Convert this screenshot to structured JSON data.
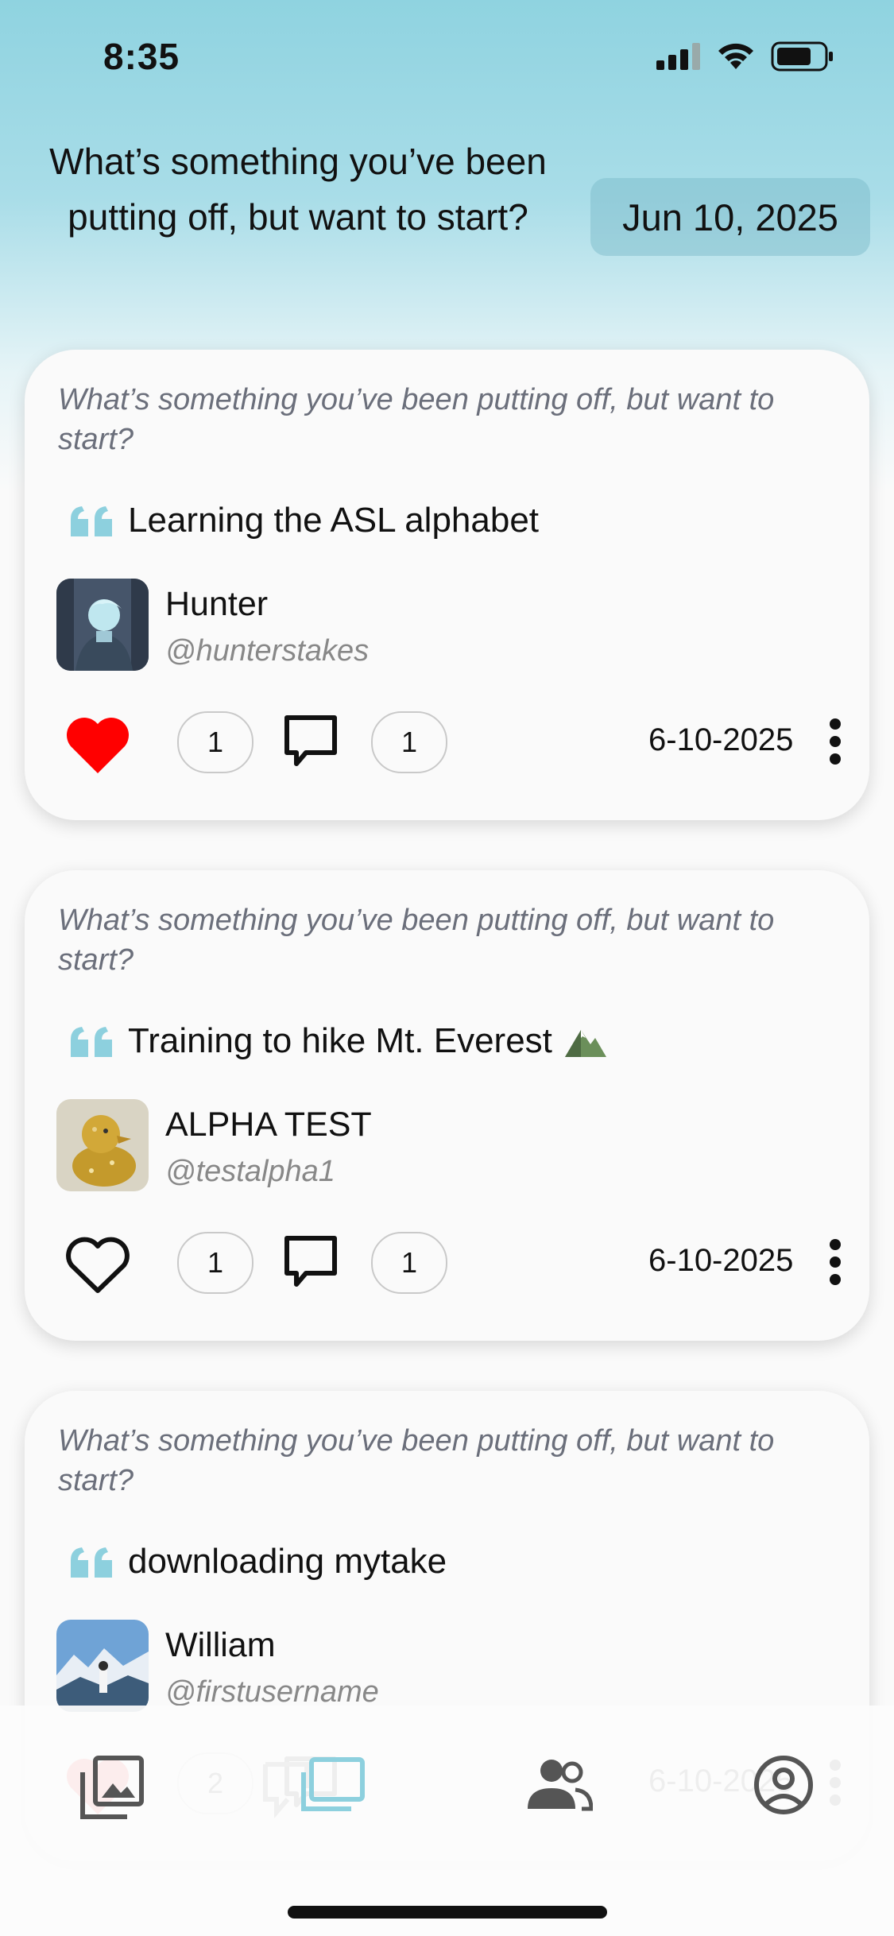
{
  "status_bar": {
    "time": "8:35"
  },
  "header": {
    "question": "What’s something you’ve been putting off, but want to start?",
    "date": "Jun 10, 2025"
  },
  "posts": [
    {
      "prompt": "What’s something you’ve been putting off, but want to start?",
      "answer": "Learning the ASL alphabet",
      "name": "Hunter",
      "handle": "@hunterstakes",
      "likes": "1",
      "comments": "1",
      "date": "6-10-2025",
      "liked": true
    },
    {
      "prompt": "What’s something you’ve been putting off, but want to start?",
      "answer": "Training to hike Mt. Everest",
      "name": "ALPHA TEST",
      "handle": "@testalpha1",
      "likes": "1",
      "comments": "1",
      "date": "6-10-2025",
      "liked": false
    },
    {
      "prompt": "What’s something you’ve been putting off, but want to start?",
      "answer": "downloading mytake",
      "name": "William",
      "handle": "@firstusername",
      "likes": "2",
      "comments": "",
      "date": "6-10-2025",
      "liked": true
    }
  ],
  "icons": [
    "quote-icon",
    "heart-icon",
    "comment-icon",
    "more-vertical-icon",
    "mountain-icon",
    "gallery-tab-icon",
    "feed-tab-icon",
    "friends-tab-icon",
    "profile-tab-icon"
  ],
  "colors": {
    "accent": "#8dd0de",
    "heart": "#ff0000",
    "active_tab": "#8dd0de",
    "inactive_tab": "#555555"
  }
}
